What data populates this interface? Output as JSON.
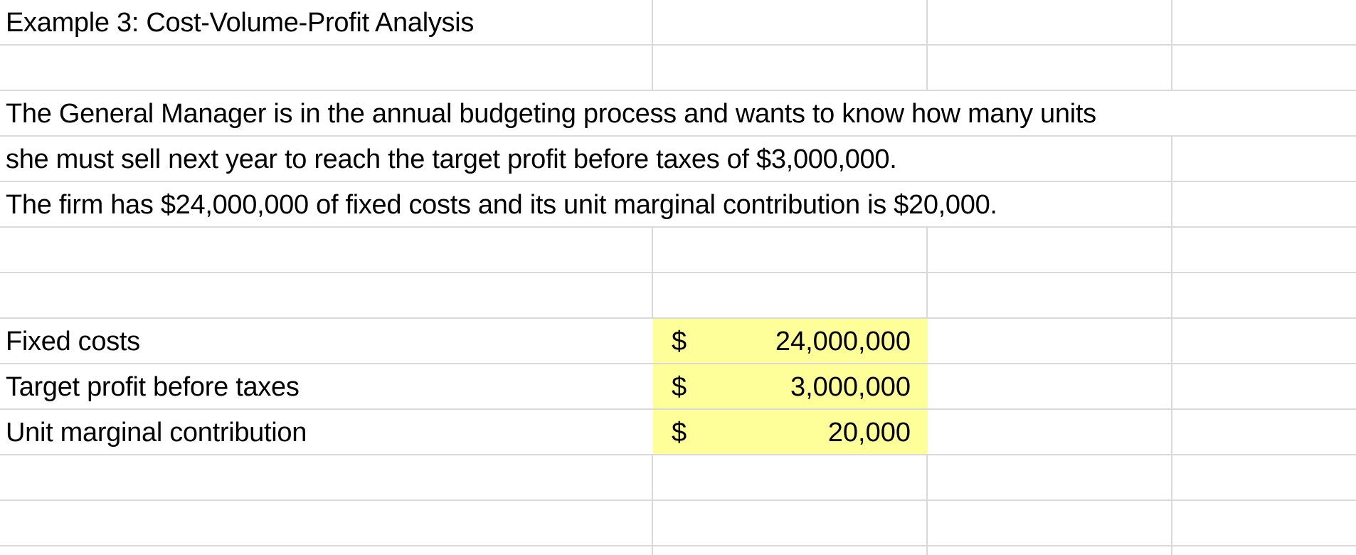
{
  "sheet": {
    "title": "Example 3: Cost-Volume-Profit Analysis",
    "paragraph_lines": [
      "The General Manager is in the annual budgeting process and wants to know how many units",
      "she must sell next year to reach the target profit before taxes of $3,000,000.",
      "The firm has $24,000,000 of fixed costs and its unit marginal contribution is $20,000."
    ],
    "inputs": [
      {
        "label": "Fixed costs",
        "currency": "$",
        "value": "24,000,000"
      },
      {
        "label": "Target profit before taxes",
        "currency": "$",
        "value": "3,000,000"
      },
      {
        "label": "Unit marginal contribution",
        "currency": "$",
        "value": "20,000"
      }
    ],
    "highlight_color": "#ffff99",
    "gridline_color": "#d9d9d9"
  }
}
